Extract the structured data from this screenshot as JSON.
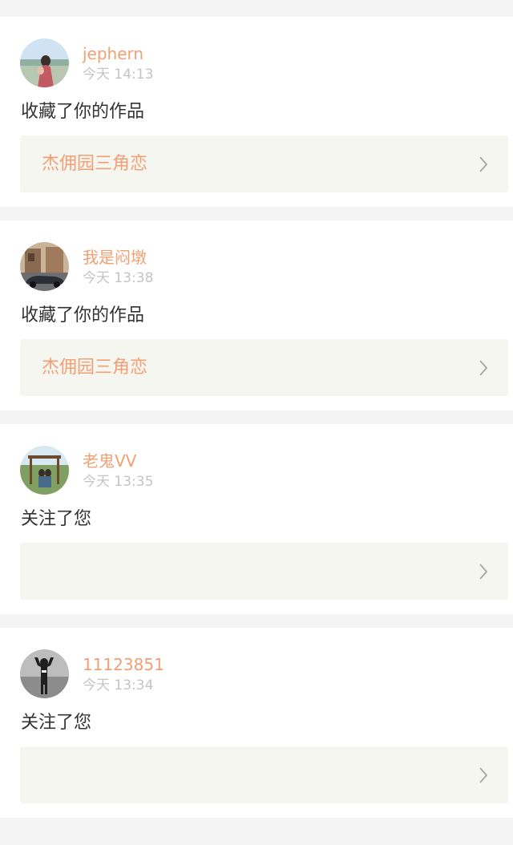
{
  "notifications": [
    {
      "username": "jephern",
      "time": "今天 14:13",
      "action": "收藏了你的作品",
      "work_title": "杰佣园三角恋"
    },
    {
      "username": "我是闷墩",
      "time": "今天 13:38",
      "action": "收藏了你的作品",
      "work_title": "杰佣园三角恋"
    },
    {
      "username": "老鬼VV",
      "time": "今天 13:35",
      "action": "关注了您",
      "work_title": ""
    },
    {
      "username": "11123851",
      "time": "今天 13:34",
      "action": "关注了您",
      "work_title": ""
    }
  ],
  "colors": {
    "username": "#f0a074",
    "work_title": "#f0a074",
    "time": "#c4c4c4",
    "action_text": "#333333",
    "work_box_bg": "#f6f6f0",
    "page_bg": "#f5f4f4"
  },
  "icons": {
    "work_box_arrow": "chevron-right-icon"
  }
}
